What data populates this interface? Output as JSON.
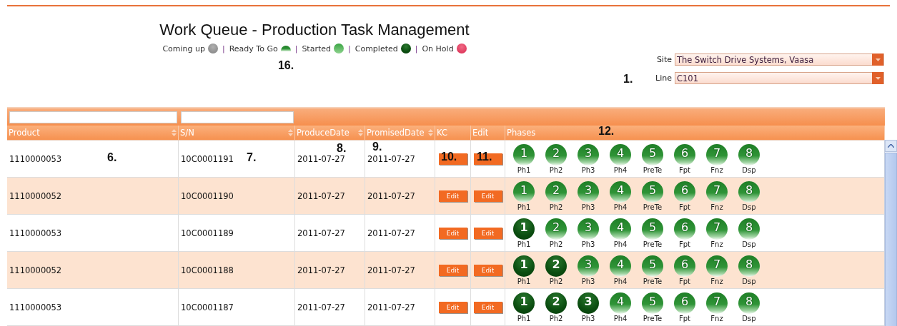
{
  "title": "Work Queue - Production Task Management",
  "legend": [
    {
      "label": "Coming up",
      "kind": "coming"
    },
    {
      "separator": "|",
      "label": "Ready To Go",
      "kind": "ready"
    },
    {
      "separator": "|",
      "label": "Started",
      "kind": "started"
    },
    {
      "separator": "|",
      "label": "Completed",
      "kind": "completed"
    },
    {
      "separator": "|",
      "label": "On Hold",
      "kind": "hold"
    }
  ],
  "legend_callout": "16.",
  "filters": {
    "site": {
      "label": "Site",
      "value": "The Switch Drive Systems, Vaasa"
    },
    "line": {
      "label": "Line",
      "value": "C101",
      "callout": "1."
    }
  },
  "table": {
    "columns": [
      {
        "label": "Product",
        "sortable": true,
        "filter": true
      },
      {
        "label": "S/N",
        "sortable": true,
        "filter": true
      },
      {
        "label": "ProduceDate",
        "sortable": true,
        "filter": false
      },
      {
        "label": "PromisedDate",
        "sortable": true,
        "filter": false
      },
      {
        "label": "KC",
        "sortable": false,
        "filter": false
      },
      {
        "label": "Edit",
        "sortable": false,
        "filter": false
      },
      {
        "label": "Phases",
        "sortable": false,
        "filter": false,
        "callout": "12."
      }
    ],
    "rows": [
      {
        "cells": [
          {
            "text": "1110000053",
            "callout": "6."
          },
          {
            "text": "10C0001191",
            "callout": "7."
          },
          {
            "text": "2011-07-27",
            "callout": "8."
          },
          {
            "text": "2011-07-27",
            "callout": "9."
          }
        ],
        "kc": {
          "callout": "10."
        },
        "edit": {
          "callout": "11."
        },
        "phases": [
          {
            "number": "1",
            "label": "Ph1",
            "kind": "ready"
          },
          {
            "number": "2",
            "label": "Ph2",
            "kind": "ready"
          },
          {
            "number": "3",
            "label": "Ph3",
            "kind": "ready"
          },
          {
            "number": "4",
            "label": "Ph4",
            "kind": "ready"
          },
          {
            "number": "5",
            "label": "PreTe",
            "kind": "ready"
          },
          {
            "number": "6",
            "label": "Fpt",
            "kind": "ready"
          },
          {
            "number": "7",
            "label": "Fnz",
            "kind": "ready"
          },
          {
            "number": "8",
            "label": "Dsp",
            "kind": "ready"
          }
        ]
      },
      {
        "cells": [
          {
            "text": "1110000052"
          },
          {
            "text": "10C0001190"
          },
          {
            "text": "2011-07-27"
          },
          {
            "text": "2011-07-27"
          }
        ],
        "kc": {
          "label": "Edit"
        },
        "edit": {
          "label": "Edit"
        },
        "phases": [
          {
            "number": "1",
            "label": "Ph1",
            "kind": "ready"
          },
          {
            "number": "2",
            "label": "Ph2",
            "kind": "ready"
          },
          {
            "number": "3",
            "label": "Ph3",
            "kind": "ready"
          },
          {
            "number": "4",
            "label": "Ph4",
            "kind": "ready"
          },
          {
            "number": "5",
            "label": "PreTe",
            "kind": "ready"
          },
          {
            "number": "6",
            "label": "Fpt",
            "kind": "ready"
          },
          {
            "number": "7",
            "label": "Fnz",
            "kind": "ready"
          },
          {
            "number": "8",
            "label": "Dsp",
            "kind": "ready"
          }
        ]
      },
      {
        "cells": [
          {
            "text": "1110000053"
          },
          {
            "text": "10C0001189"
          },
          {
            "text": "2011-07-27"
          },
          {
            "text": "2011-07-27"
          }
        ],
        "kc": {
          "label": "Edit"
        },
        "edit": {
          "label": "Edit"
        },
        "phases": [
          {
            "number": "1",
            "label": "Ph1",
            "kind": "completed"
          },
          {
            "number": "2",
            "label": "Ph2",
            "kind": "ready"
          },
          {
            "number": "3",
            "label": "Ph3",
            "kind": "ready"
          },
          {
            "number": "4",
            "label": "Ph4",
            "kind": "ready"
          },
          {
            "number": "5",
            "label": "PreTe",
            "kind": "ready"
          },
          {
            "number": "6",
            "label": "Fpt",
            "kind": "ready"
          },
          {
            "number": "7",
            "label": "Fnz",
            "kind": "ready"
          },
          {
            "number": "8",
            "label": "Dsp",
            "kind": "ready"
          }
        ]
      },
      {
        "cells": [
          {
            "text": "1110000052"
          },
          {
            "text": "10C0001188"
          },
          {
            "text": "2011-07-27"
          },
          {
            "text": "2011-07-27"
          }
        ],
        "kc": {
          "label": "Edit"
        },
        "edit": {
          "label": "Edit"
        },
        "phases": [
          {
            "number": "1",
            "label": "Ph1",
            "kind": "completed"
          },
          {
            "number": "2",
            "label": "Ph2",
            "kind": "completed"
          },
          {
            "number": "3",
            "label": "Ph3",
            "kind": "ready"
          },
          {
            "number": "4",
            "label": "Ph4",
            "kind": "ready"
          },
          {
            "number": "5",
            "label": "PreTe",
            "kind": "ready"
          },
          {
            "number": "6",
            "label": "Fpt",
            "kind": "ready"
          },
          {
            "number": "7",
            "label": "Fnz",
            "kind": "ready"
          },
          {
            "number": "8",
            "label": "Dsp",
            "kind": "ready"
          }
        ]
      },
      {
        "cells": [
          {
            "text": "1110000053"
          },
          {
            "text": "10C0001187"
          },
          {
            "text": "2011-07-27"
          },
          {
            "text": "2011-07-27"
          }
        ],
        "kc": {
          "label": "Edit"
        },
        "edit": {
          "label": "Edit"
        },
        "phases": [
          {
            "number": "1",
            "label": "Ph1",
            "kind": "completed"
          },
          {
            "number": "2",
            "label": "Ph2",
            "kind": "completed"
          },
          {
            "number": "3",
            "label": "Ph3",
            "kind": "completed"
          },
          {
            "number": "4",
            "label": "Ph4",
            "kind": "ready"
          },
          {
            "number": "5",
            "label": "PreTe",
            "kind": "ready"
          },
          {
            "number": "6",
            "label": "Fpt",
            "kind": "ready"
          },
          {
            "number": "7",
            "label": "Fnz",
            "kind": "ready"
          },
          {
            "number": "8",
            "label": "Dsp",
            "kind": "ready"
          }
        ]
      }
    ]
  }
}
